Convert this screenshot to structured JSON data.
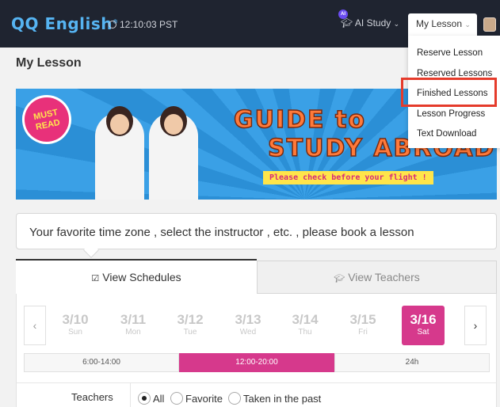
{
  "header": {
    "logo": "QQ English",
    "clock": "12:10:03 PST",
    "ai_badge": "AI",
    "ai_study": "AI Study",
    "my_lesson": "My Lesson"
  },
  "dropdown": {
    "items": [
      "Reserve Lesson",
      "Reserved Lessons",
      "Finished Lessons",
      "Lesson Progress",
      "Text Download"
    ]
  },
  "page_title": "My Lesson",
  "banner": {
    "must_read": "MUST READ",
    "guide_line1": "GUIDE to",
    "guide_line2": "STUDY ABROAD",
    "flight_note": "Please check before your flight !"
  },
  "info": "Your favorite time zone , select the instructor , etc. , please book a lesson",
  "tabs": {
    "schedules": "View Schedules",
    "teachers": "View Teachers"
  },
  "days": [
    {
      "date": "3/10",
      "weekday": "Sun"
    },
    {
      "date": "3/11",
      "weekday": "Mon"
    },
    {
      "date": "3/12",
      "weekday": "Tue"
    },
    {
      "date": "3/13",
      "weekday": "Wed"
    },
    {
      "date": "3/14",
      "weekday": "Thu"
    },
    {
      "date": "3/15",
      "weekday": "Fri"
    },
    {
      "date": "3/16",
      "weekday": "Sat"
    }
  ],
  "time_slots": [
    "6:00-14:00",
    "12:00-20:00",
    "24h"
  ],
  "filter": {
    "label": "Teachers",
    "options": [
      "All",
      "Favorite",
      "Taken in the past"
    ]
  },
  "colors": {
    "accent": "#d6398c",
    "header_bg": "#1f2430",
    "highlight": "#e53b2b"
  }
}
